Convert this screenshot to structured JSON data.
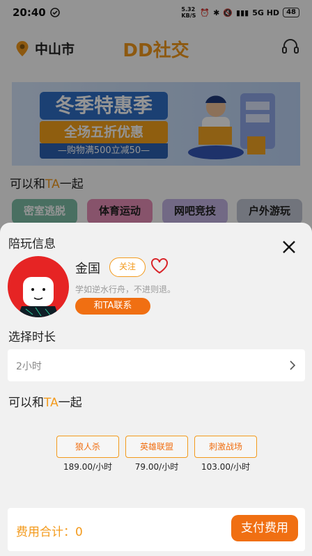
{
  "status_bar": {
    "time": "20:40",
    "net_speed": "5.32 KB/S",
    "signal": "5G HD",
    "battery": "48"
  },
  "header": {
    "city": "中山市",
    "title": "DD社交"
  },
  "banner": {
    "headline": "冬季特惠季",
    "promo": "全场五折优惠",
    "promo_sub": "—购物满500立减50—"
  },
  "background_section": {
    "title_prefix": "可以和",
    "title_ta": "TA",
    "title_suffix": "一起",
    "categories": [
      {
        "label": "密室逃脱",
        "color": "#7fbfa8"
      },
      {
        "label": "体育运动",
        "color": "#e88fb8"
      },
      {
        "label": "网吧竞技",
        "color": "#c4b6e6"
      },
      {
        "label": "户外游玩",
        "color": "#c3c9d6"
      }
    ]
  },
  "sheet": {
    "title": "陪玩信息",
    "name": "金国",
    "follow_label": "关注",
    "motto": "学如逆水行舟，不进则退。",
    "contact_label": "和TA联系",
    "duration_label": "选择时长",
    "duration_value": "2小时",
    "together_prefix": "可以和",
    "together_ta": "TA",
    "together_suffix": "一起",
    "games": [
      {
        "name": "狼人杀",
        "price": "189.00/小时"
      },
      {
        "name": "英雄联盟",
        "price": "79.00/小时"
      },
      {
        "name": "刺激战场",
        "price": "103.00/小时"
      }
    ],
    "total_label": "费用合计：0",
    "pay_label": "支付费用"
  },
  "colors": {
    "accent": "#f39a1c",
    "button": "#f06f12",
    "avatar_bg": "#e62424"
  }
}
